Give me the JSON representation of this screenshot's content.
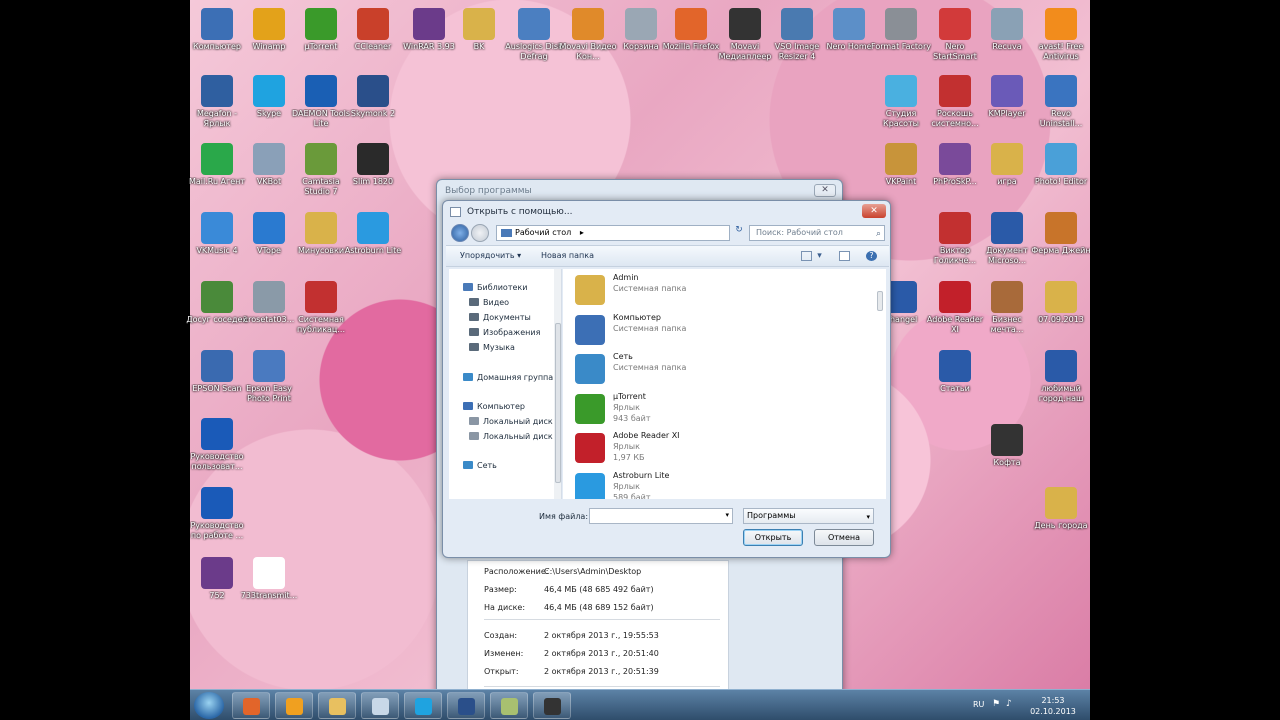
{
  "desktop_icons": [
    {
      "label": "Компьютер",
      "color": "#3c6fb5"
    },
    {
      "label": "Winamp",
      "color": "#e3a21a"
    },
    {
      "label": "µTorrent",
      "color": "#3a9a2a"
    },
    {
      "label": "CCleaner",
      "color": "#c9402a"
    },
    {
      "label": "WinRAR 3.93",
      "color": "#6b3b8a"
    },
    {
      "label": "BK",
      "color": "#d9b24a"
    },
    {
      "label": "Auslogics Disk Defrag",
      "color": "#4b7fc1"
    },
    {
      "label": "Movavi Видео Кон...",
      "color": "#e08a2a"
    },
    {
      "label": "Корзина",
      "color": "#9aa7b4"
    },
    {
      "label": "Mozilla Firefox",
      "color": "#e2652a"
    },
    {
      "label": "Movavi Медиаплеер",
      "color": "#333333"
    },
    {
      "label": "VSO Image Resizer 4",
      "color": "#4a7ab0"
    },
    {
      "label": "Nero Home",
      "color": "#5c8fc8"
    },
    {
      "label": "Format Factory",
      "color": "#8a8f96"
    },
    {
      "label": "Nero StartSmart",
      "color": "#d23a3a"
    },
    {
      "label": "Recuva",
      "color": "#8aa1b5"
    },
    {
      "label": "avast! Free Antivirus",
      "color": "#f28c1c"
    },
    {
      "label": "Megafon - Ярлык",
      "color": "#2f5fa0"
    },
    {
      "label": "Skype",
      "color": "#1fa3e0"
    },
    {
      "label": "DAEMON Tools Lite",
      "color": "#1a5fb4"
    },
    {
      "label": "Skymonk 2",
      "color": "#2a4f8a"
    },
    {
      "label": "Студия Красоты",
      "color": "#4ab0e0"
    },
    {
      "label": "Роскошь системно...",
      "color": "#c23030"
    },
    {
      "label": "KMPlayer",
      "color": "#6a5ab8"
    },
    {
      "label": "Revo Uninstall...",
      "color": "#3a74c0"
    },
    {
      "label": "Mail.Ru Агент",
      "color": "#2aa84a"
    },
    {
      "label": "VKBot",
      "color": "#8aa0b8"
    },
    {
      "label": "Camtasia Studio 7",
      "color": "#6a9a3a"
    },
    {
      "label": "Slim 1820",
      "color": "#2a2a2a"
    },
    {
      "label": "VKPaint",
      "color": "#c8943a"
    },
    {
      "label": "PhProSkP...",
      "color": "#7a4a9a"
    },
    {
      "label": "игра",
      "color": "#d9b24a"
    },
    {
      "label": "Photo! Editor",
      "color": "#4aa0d8"
    },
    {
      "label": "VKMusic 4",
      "color": "#3a8ad8"
    },
    {
      "label": "VTope",
      "color": "#2a7ad0"
    },
    {
      "label": "Минусовки",
      "color": "#d9b24a"
    },
    {
      "label": "Astroburn Lite",
      "color": "#2a9ae0"
    },
    {
      "label": "Виктор Голикче...",
      "color": "#c23030"
    },
    {
      "label": "Документ Microso...",
      "color": "#2a5aa8"
    },
    {
      "label": "Ферма Джейн",
      "color": "#c8742a"
    },
    {
      "label": "Досуг соседей",
      "color": "#4a8a3a"
    },
    {
      "label": "crosetat03...",
      "color": "#8a9aa8"
    },
    {
      "label": "Системная публикац...",
      "color": "#c23030"
    },
    {
      "label": "Khangel",
      "color": "#2a5aa8"
    },
    {
      "label": "Adobe Reader XI",
      "color": "#c2202a"
    },
    {
      "label": "Бизнес мечта...",
      "color": "#a86a3a"
    },
    {
      "label": "07.09.2013",
      "color": "#d9b24a"
    },
    {
      "label": "EPSON Scan",
      "color": "#3a6ab0"
    },
    {
      "label": "Epson Easy Photo Print",
      "color": "#4a7ac0"
    },
    {
      "label": "Статьи",
      "color": "#2a5aa8"
    },
    {
      "label": "любимый город.наш",
      "color": "#2a5aa8"
    },
    {
      "label": "Руководство пользоват...",
      "color": "#1a5ab8"
    },
    {
      "label": "Кофта",
      "color": "#333333"
    },
    {
      "label": "Руководство по работе ...",
      "color": "#1a5ab8"
    },
    {
      "label": "День города",
      "color": "#d9b24a"
    },
    {
      "label": "752",
      "color": "#6b3b8a"
    },
    {
      "label": "733transmit...",
      "color": "#ffffff"
    }
  ],
  "background_dialog": {
    "title": "Выбор программы",
    "close_label": "✕",
    "properties": [
      {
        "key": "Расположение:",
        "value": "C:\\Users\\Admin\\Desktop"
      },
      {
        "key": "Размер:",
        "value": "46,4 МБ (48 685 492 байт)"
      },
      {
        "key": "На диске:",
        "value": "46,4 МБ (48 689 152 байт)"
      },
      {
        "key": "Создан:",
        "value": "2 октября 2013 г., 19:55:53"
      },
      {
        "key": "Изменен:",
        "value": "2 октября 2013 г., 20:51:40"
      },
      {
        "key": "Открыт:",
        "value": "2 октября 2013 г., 20:51:39"
      }
    ]
  },
  "open_dialog": {
    "title": "Открыть с помощью...",
    "close_label": "✕",
    "address": "Рабочий стол",
    "address_arrow": "▸",
    "refresh_glyph": "↻",
    "search_placeholder": "Поиск: Рабочий стол",
    "search_glyph": "⌕",
    "toolbar": {
      "organize": "Упорядочить ▾",
      "new_folder": "Новая папка",
      "view_glyph": "▾",
      "help_glyph": "?"
    },
    "nav": [
      {
        "label": "Библиотеки",
        "color": "#4a7ab8",
        "indent": false
      },
      {
        "label": "Видео",
        "color": "#5a6a7a",
        "indent": true
      },
      {
        "label": "Документы",
        "color": "#5a6a7a",
        "indent": true
      },
      {
        "label": "Изображения",
        "color": "#5a6a7a",
        "indent": true
      },
      {
        "label": "Музыка",
        "color": "#5a6a7a",
        "indent": true
      },
      {
        "label": "Домашняя группа",
        "color": "#3a8ac8",
        "indent": false
      },
      {
        "label": "Компьютер",
        "color": "#3c6fb5",
        "indent": false
      },
      {
        "label": "Локальный диск",
        "color": "#8a96a4",
        "indent": true
      },
      {
        "label": "Локальный диск",
        "color": "#8a96a4",
        "indent": true
      },
      {
        "label": "Сеть",
        "color": "#3a8ac8",
        "indent": false
      }
    ],
    "files": [
      {
        "name": "Admin",
        "type": "Системная папка",
        "size": "",
        "color": "#d9b24a"
      },
      {
        "name": "Компьютер",
        "type": "Системная папка",
        "size": "",
        "color": "#3c6fb5"
      },
      {
        "name": "Сеть",
        "type": "Системная папка",
        "size": "",
        "color": "#3a8ac8"
      },
      {
        "name": "µTorrent",
        "type": "Ярлык",
        "size": "943 байт",
        "color": "#3a9a2a"
      },
      {
        "name": "Adobe Reader XI",
        "type": "Ярлык",
        "size": "1,97 КБ",
        "color": "#c2202a"
      },
      {
        "name": "Astroburn Lite",
        "type": "Ярлык",
        "size": "589 байт",
        "color": "#2a9ae0"
      }
    ],
    "filename_label": "Имя файла:",
    "filename_value": "",
    "filetype": "Программы",
    "dropdown_glyph": "▾",
    "open_button": "Открыть",
    "cancel_button": "Отмена"
  },
  "taskbar": {
    "apps": [
      {
        "name": "Firefox",
        "color": "#e2652a"
      },
      {
        "name": "Media Player",
        "color": "#f0a020"
      },
      {
        "name": "Explorer",
        "color": "#e8c060"
      },
      {
        "name": "Calculator",
        "color": "#c8d8e8"
      },
      {
        "name": "Skype",
        "color": "#1fa3e0"
      },
      {
        "name": "Skymonk",
        "color": "#2a4f8a"
      },
      {
        "name": "Camtasia",
        "color": "#a8c070"
      },
      {
        "name": "Movavi",
        "color": "#333333"
      }
    ],
    "language": "RU",
    "time": "21:53",
    "date": "02.10.2013"
  }
}
